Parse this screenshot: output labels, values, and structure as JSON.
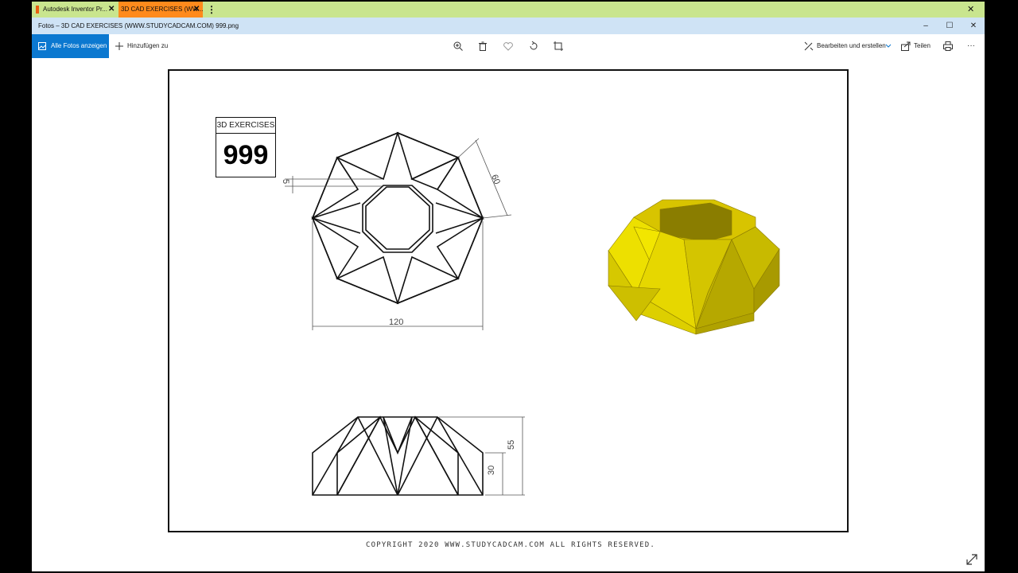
{
  "browser": {
    "tabs": [
      {
        "label": "Autodesk Inventor Pr...",
        "close": "✕"
      },
      {
        "label": "3D CAD EXERCISES (WW...",
        "close": "✕"
      }
    ],
    "more": "⋮",
    "close": "✕"
  },
  "window": {
    "title": "Fotos – 3D CAD EXERCISES (WWW.STUDYCADCAM.COM) 999.png",
    "minimize": "–",
    "maximize": "☐",
    "close": "✕"
  },
  "toolbar": {
    "all_photos": "Alle Fotos anzeigen",
    "add_to": "Hinzufügen zu",
    "edit_create": "Bearbeiten und erstellen",
    "share": "Teilen",
    "more": "···",
    "icons": [
      "zoom-icon",
      "delete-icon",
      "favorite-icon",
      "rotate-icon",
      "crop-icon",
      "print-icon"
    ]
  },
  "drawing": {
    "header": "3D EXERCISES",
    "number": "999",
    "dimensions": {
      "width": "120",
      "diagonal": "60",
      "offset": "5",
      "height_total": "55",
      "height_lower": "30"
    },
    "copyright": "COPYRIGHT  2020 WWW.STUDYCADCAM.COM ALL RIGHTS RESERVED.",
    "model_color": "#e8d800"
  }
}
